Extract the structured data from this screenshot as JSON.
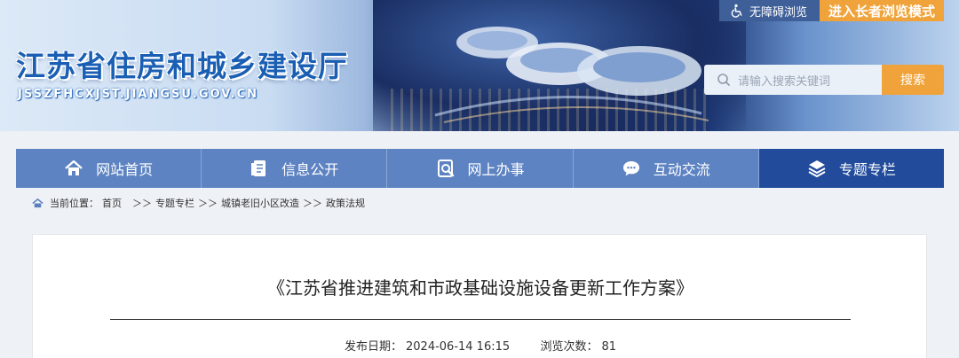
{
  "header": {
    "site_title": "江苏省住房和城乡建设厅",
    "site_domain": "JSSZFHCXJST.JIANGSU.GOV.CN",
    "accessibility_label": "无障碍浏览",
    "elder_mode_label": "进入长者浏览模式"
  },
  "search": {
    "placeholder": "请输入搜索关键词",
    "button_label": "搜索"
  },
  "nav": {
    "items": [
      {
        "label": "网站首页",
        "icon": "home-icon"
      },
      {
        "label": "信息公开",
        "icon": "document-icon"
      },
      {
        "label": "网上办事",
        "icon": "service-search-icon"
      },
      {
        "label": "互动交流",
        "icon": "chat-icon"
      },
      {
        "label": "专题专栏",
        "icon": "layers-icon",
        "active": true
      }
    ]
  },
  "breadcrumb": {
    "prefix": "当前位置：",
    "items": [
      "首页",
      "专题专栏",
      "城镇老旧小区改造",
      "政策法规"
    ],
    "separator": "＞＞"
  },
  "article": {
    "title": "《江苏省推进建筑和市政基础设施设备更新工作方案》",
    "publish_label": "发布日期：",
    "publish_date": "2024-06-14 16:15",
    "views_label": "浏览次数：",
    "views": "81"
  },
  "colors": {
    "brand_blue": "#1a5fb4",
    "nav_blue": "#5d83c2",
    "nav_active": "#224c9b",
    "accent_orange": "#f0a33a"
  }
}
